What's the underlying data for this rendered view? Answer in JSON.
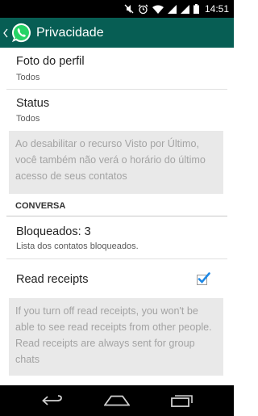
{
  "status_bar": {
    "time": "14:51",
    "icons": [
      "silent-icon",
      "alarm-icon",
      "wifi-icon",
      "signal-icon",
      "signal-icon",
      "battery-icon"
    ]
  },
  "action_bar": {
    "title": "Privacidade",
    "back_icon": "chevron-left-icon",
    "logo_icon": "whatsapp-logo",
    "brand_color": "#075e54"
  },
  "settings": {
    "profile_photo": {
      "title": "Foto do perfil",
      "summary": "Todos"
    },
    "status": {
      "title": "Status",
      "summary": "Todos"
    },
    "last_seen_info": "Ao desabilitar o recurso Visto por Último, você também não verá o horário do último acesso de seus contatos",
    "section_conversa": "CONVERSA",
    "blocked": {
      "title": "Bloqueados: 3",
      "summary": "Lista dos contatos bloqueados."
    },
    "read_receipts": {
      "title": "Read receipts",
      "checked": true,
      "check_color": "#1e88e5"
    },
    "read_receipts_info": "If you turn off read receipts, you won't be able to see read receipts from other people. Read receipts are always sent for group chats"
  },
  "nav_bar": {
    "buttons": [
      "back-icon",
      "home-icon",
      "recent-apps-icon"
    ]
  }
}
